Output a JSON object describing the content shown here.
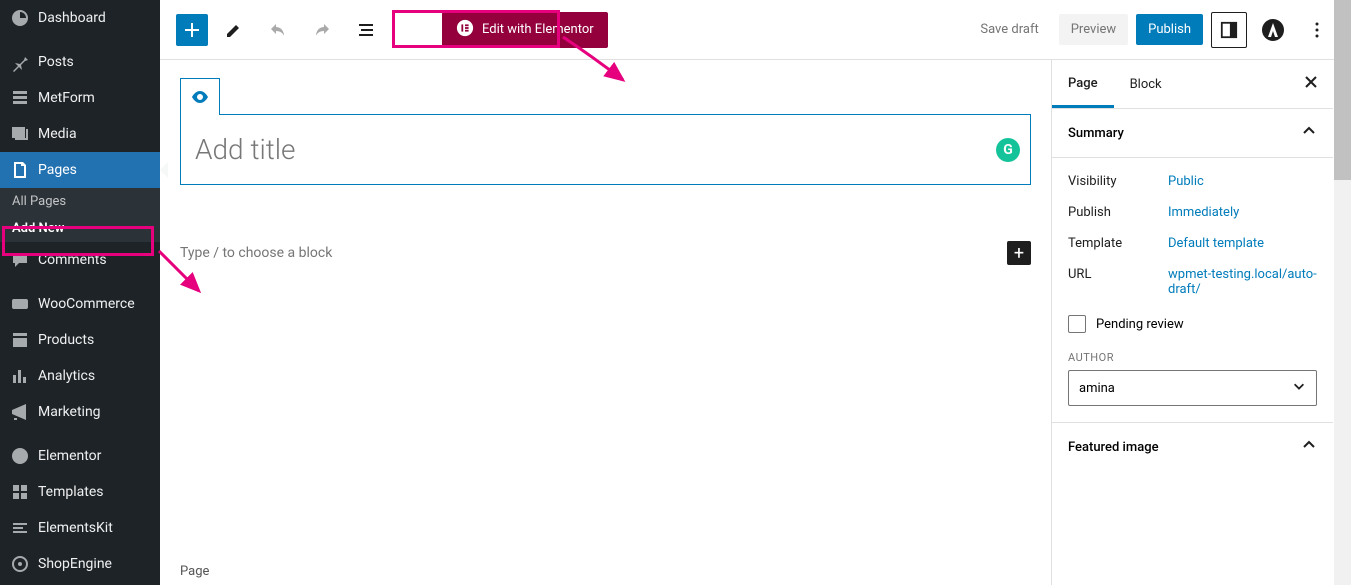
{
  "sidebar": {
    "items": [
      {
        "label": "Dashboard"
      },
      {
        "label": "Posts"
      },
      {
        "label": "MetForm"
      },
      {
        "label": "Media"
      },
      {
        "label": "Pages"
      },
      {
        "label": "Comments"
      },
      {
        "label": "WooCommerce"
      },
      {
        "label": "Products"
      },
      {
        "label": "Analytics"
      },
      {
        "label": "Marketing"
      },
      {
        "label": "Elementor"
      },
      {
        "label": "Templates"
      },
      {
        "label": "ElementsKit"
      },
      {
        "label": "ShopEngine"
      }
    ],
    "sub": {
      "all": "All Pages",
      "addnew": "Add New"
    }
  },
  "toolbar": {
    "elementor_label": "Edit with Elementor",
    "save_draft": "Save draft",
    "preview": "Preview",
    "publish": "Publish"
  },
  "editor": {
    "title_placeholder": "Add title",
    "block_placeholder": "Type / to choose a block",
    "footer": "Page",
    "grammarly": "G"
  },
  "panel": {
    "tab_page": "Page",
    "tab_block": "Block",
    "summary": "Summary",
    "visibility_label": "Visibility",
    "visibility_value": "Public",
    "publish_label": "Publish",
    "publish_value": "Immediately",
    "template_label": "Template",
    "template_value": "Default template",
    "url_label": "URL",
    "url_value": "wpmet-testing.local/auto-draft/",
    "pending": "Pending review",
    "author_label": "AUTHOR",
    "author_value": "amina",
    "featured": "Featured image"
  }
}
